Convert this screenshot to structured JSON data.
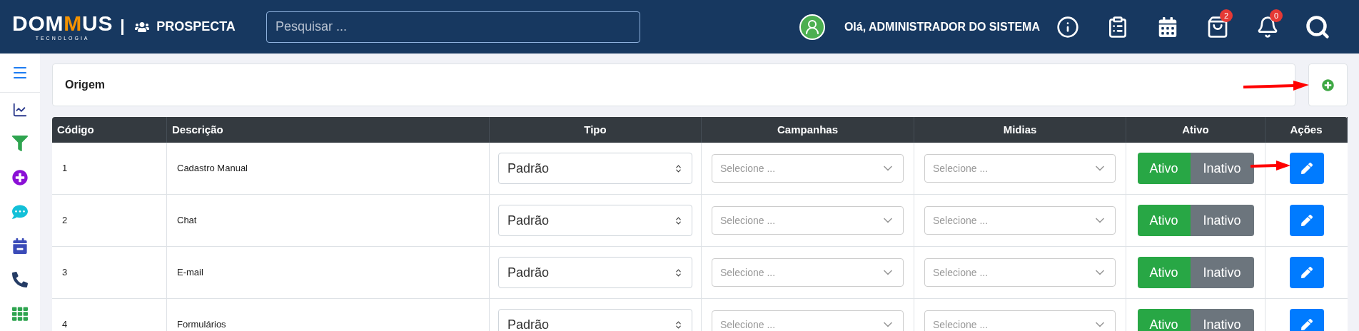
{
  "header": {
    "logo": {
      "parts": [
        "DOM",
        "M",
        "US"
      ],
      "tagline": "TECNOLOGIA"
    },
    "module": "PROSPECTA",
    "search": {
      "placeholder": "Pesquisar ..."
    },
    "greeting": "Olá, ADMINISTRADOR DO SISTEMA",
    "icons": [
      {
        "kind": "info"
      },
      {
        "kind": "report"
      },
      {
        "kind": "calendar"
      },
      {
        "kind": "tasks",
        "badge": "2"
      },
      {
        "kind": "notifications",
        "badge": "0"
      },
      {
        "kind": "search"
      }
    ]
  },
  "sidebar": {
    "items": [
      {
        "kind": "menu"
      },
      {
        "kind": "chart"
      },
      {
        "kind": "funnel"
      },
      {
        "kind": "add"
      },
      {
        "kind": "chat"
      },
      {
        "kind": "calendar"
      },
      {
        "kind": "phone"
      },
      {
        "kind": "grid"
      }
    ]
  },
  "page": {
    "title": "Origem"
  },
  "table": {
    "columns": [
      "Código",
      "Descrição",
      "Tipo",
      "Campanhas",
      "Midias",
      "Ativo",
      "Ações"
    ],
    "rows": [
      {
        "code": "1",
        "description": "Cadastro Manual",
        "tipo": "Padrão",
        "campanhas": {
          "placeholder": "Selecione ..."
        },
        "midias": {
          "placeholder": "Selecione ..."
        },
        "toggle": [
          "Ativo",
          "Inativo"
        ],
        "active": true
      },
      {
        "code": "2",
        "description": "Chat",
        "tipo": "Padrão",
        "campanhas": {
          "placeholder": "Selecione ..."
        },
        "midias": {
          "placeholder": "Selecione ..."
        },
        "toggle": [
          "Ativo",
          "Inativo"
        ],
        "active": true
      },
      {
        "code": "3",
        "description": "E-mail",
        "tipo": "Padrão",
        "campanhas": {
          "placeholder": "Selecione ..."
        },
        "midias": {
          "placeholder": "Selecione ..."
        },
        "toggle": [
          "Ativo",
          "Inativo"
        ],
        "active": true
      },
      {
        "code": "4",
        "description": "Formulários",
        "tipo": "Padrão",
        "campanhas": {
          "placeholder": "Selecione ..."
        },
        "midias": {
          "placeholder": "Selecione ..."
        },
        "toggle": [
          "Ativo",
          "Inativo"
        ],
        "active": true
      }
    ]
  }
}
